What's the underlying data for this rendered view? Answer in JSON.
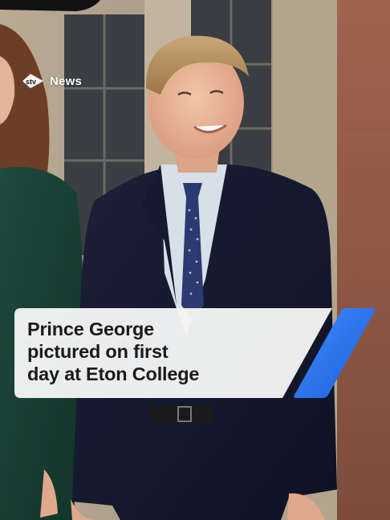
{
  "brand": {
    "logo_text": "News",
    "accent_color": "#2f7df0"
  },
  "headline": {
    "lines": [
      "Prince George",
      "pictured on first",
      "day at Eton College"
    ]
  },
  "colors": {
    "card_bg": "#f5f5f5",
    "text": "#1a1a1a"
  }
}
